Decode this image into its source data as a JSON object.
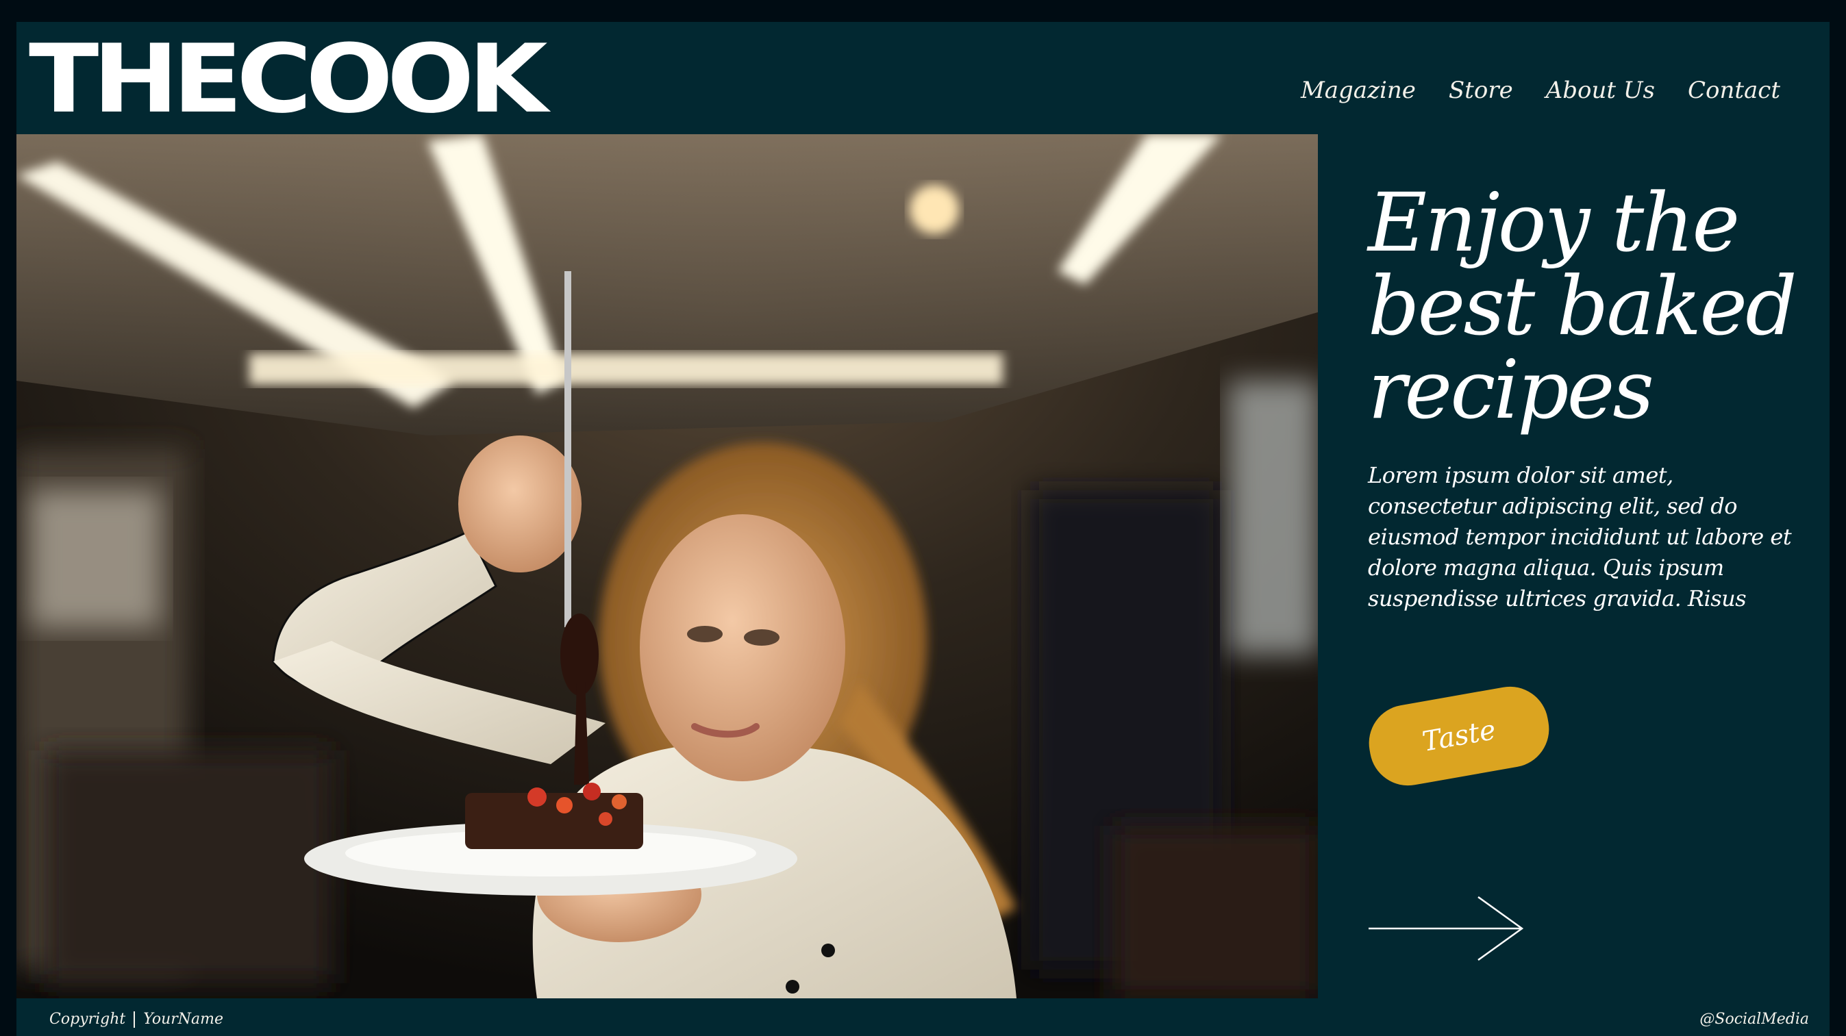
{
  "brand": {
    "logo_text": "THECOOK"
  },
  "nav": {
    "items": [
      {
        "label": "Magazine"
      },
      {
        "label": "Store"
      },
      {
        "label": "About Us"
      },
      {
        "label": "Contact"
      }
    ]
  },
  "hero": {
    "headline": "Enjoy the best baked recipes",
    "body": "Lorem ipsum dolor sit amet, consectetur adipiscing elit, sed do eiusmod tempor incididunt ut labore et dolore magna aliqua. Quis ipsum suspendisse ultrices gravida. Risus",
    "cta_label": "Taste",
    "arrow_icon": "arrow-right-icon"
  },
  "footer": {
    "copyright": "Copyright",
    "author": "YourName",
    "social": "@SocialMedia"
  },
  "colors": {
    "background": "#022831",
    "outer": "#000c13",
    "accent": "#dba420",
    "text": "#ffffff"
  }
}
